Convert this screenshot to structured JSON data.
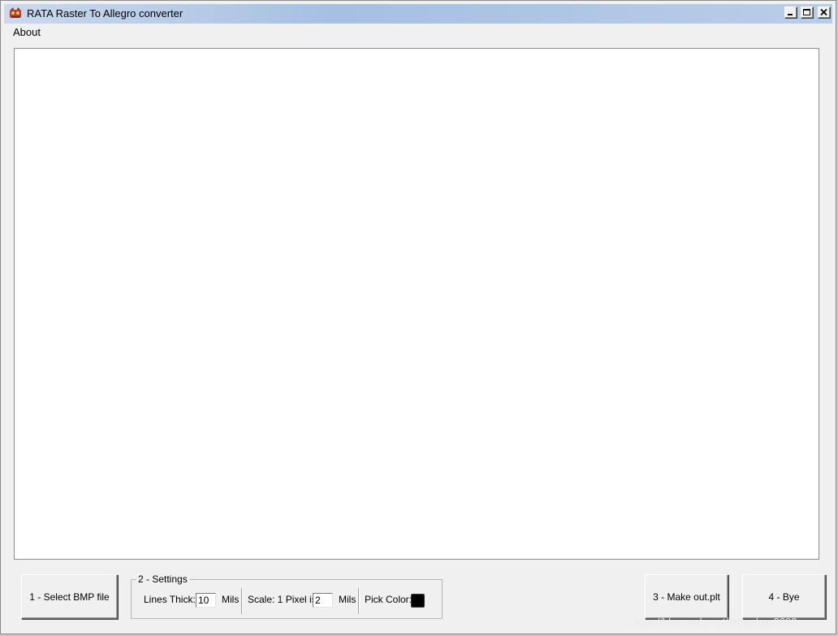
{
  "window": {
    "title": "RATA Raster To Allegro converter",
    "icon": "rata-app-icon",
    "controls": {
      "minimize": "minimize-icon",
      "maximize": "maximize-icon",
      "close": "close-icon"
    }
  },
  "menu": {
    "items": [
      {
        "label": "About"
      }
    ]
  },
  "buttons": {
    "select_bmp": "1 - Select BMP file",
    "make_out": "3 - Make out.plt",
    "bye": "4 - Bye"
  },
  "settings": {
    "legend": "2 - Settings",
    "lines_thick_label": "Lines Thick:",
    "lines_thick_value": "10",
    "lines_thick_unit": "Mils",
    "scale_label": "Scale:  1 Pixel is",
    "scale_value": "2",
    "scale_unit": "Mils",
    "pick_color_label": "Pick Color:",
    "pick_color_value": "#000000"
  },
  "watermark": "https://blog.csdn.net/jiangchao3392",
  "colors": {
    "titlebar": "#a6c0e2",
    "window_bg": "#f0f0f0",
    "canvas_bg": "#ffffff"
  }
}
